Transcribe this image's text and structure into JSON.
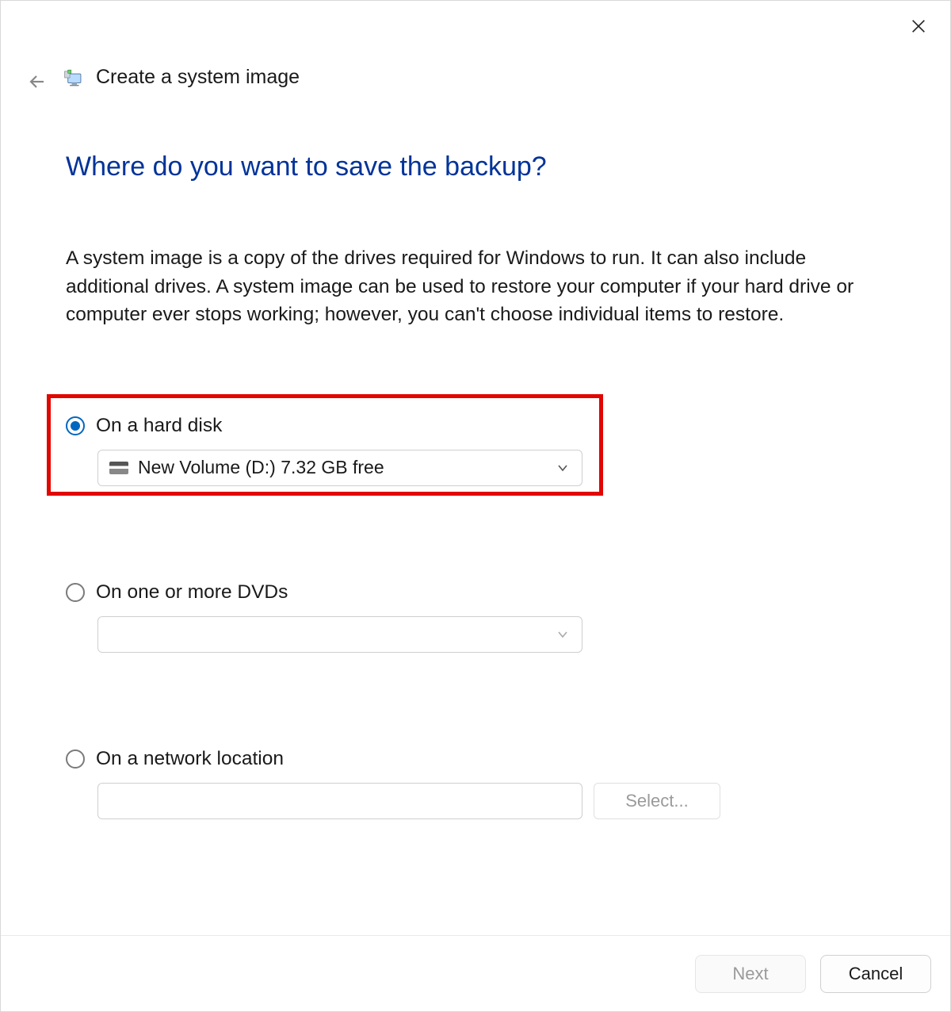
{
  "header": {
    "page_name": "Create a system image"
  },
  "main": {
    "heading": "Where do you want to save the backup?",
    "description": "A system image is a copy of the drives required for Windows to run. It can also include additional drives. A system image can be used to restore your computer if your hard drive or computer ever stops working; however, you can't choose individual items to restore."
  },
  "options": {
    "hard_disk": {
      "label": "On a hard disk",
      "selected": true,
      "dropdown_value": "New Volume (D:)  7.32 GB free"
    },
    "dvds": {
      "label": "On one or more DVDs",
      "selected": false,
      "dropdown_value": ""
    },
    "network": {
      "label": "On a network location",
      "selected": false,
      "path_value": "",
      "select_button": "Select..."
    }
  },
  "footer": {
    "next": "Next",
    "cancel": "Cancel"
  }
}
